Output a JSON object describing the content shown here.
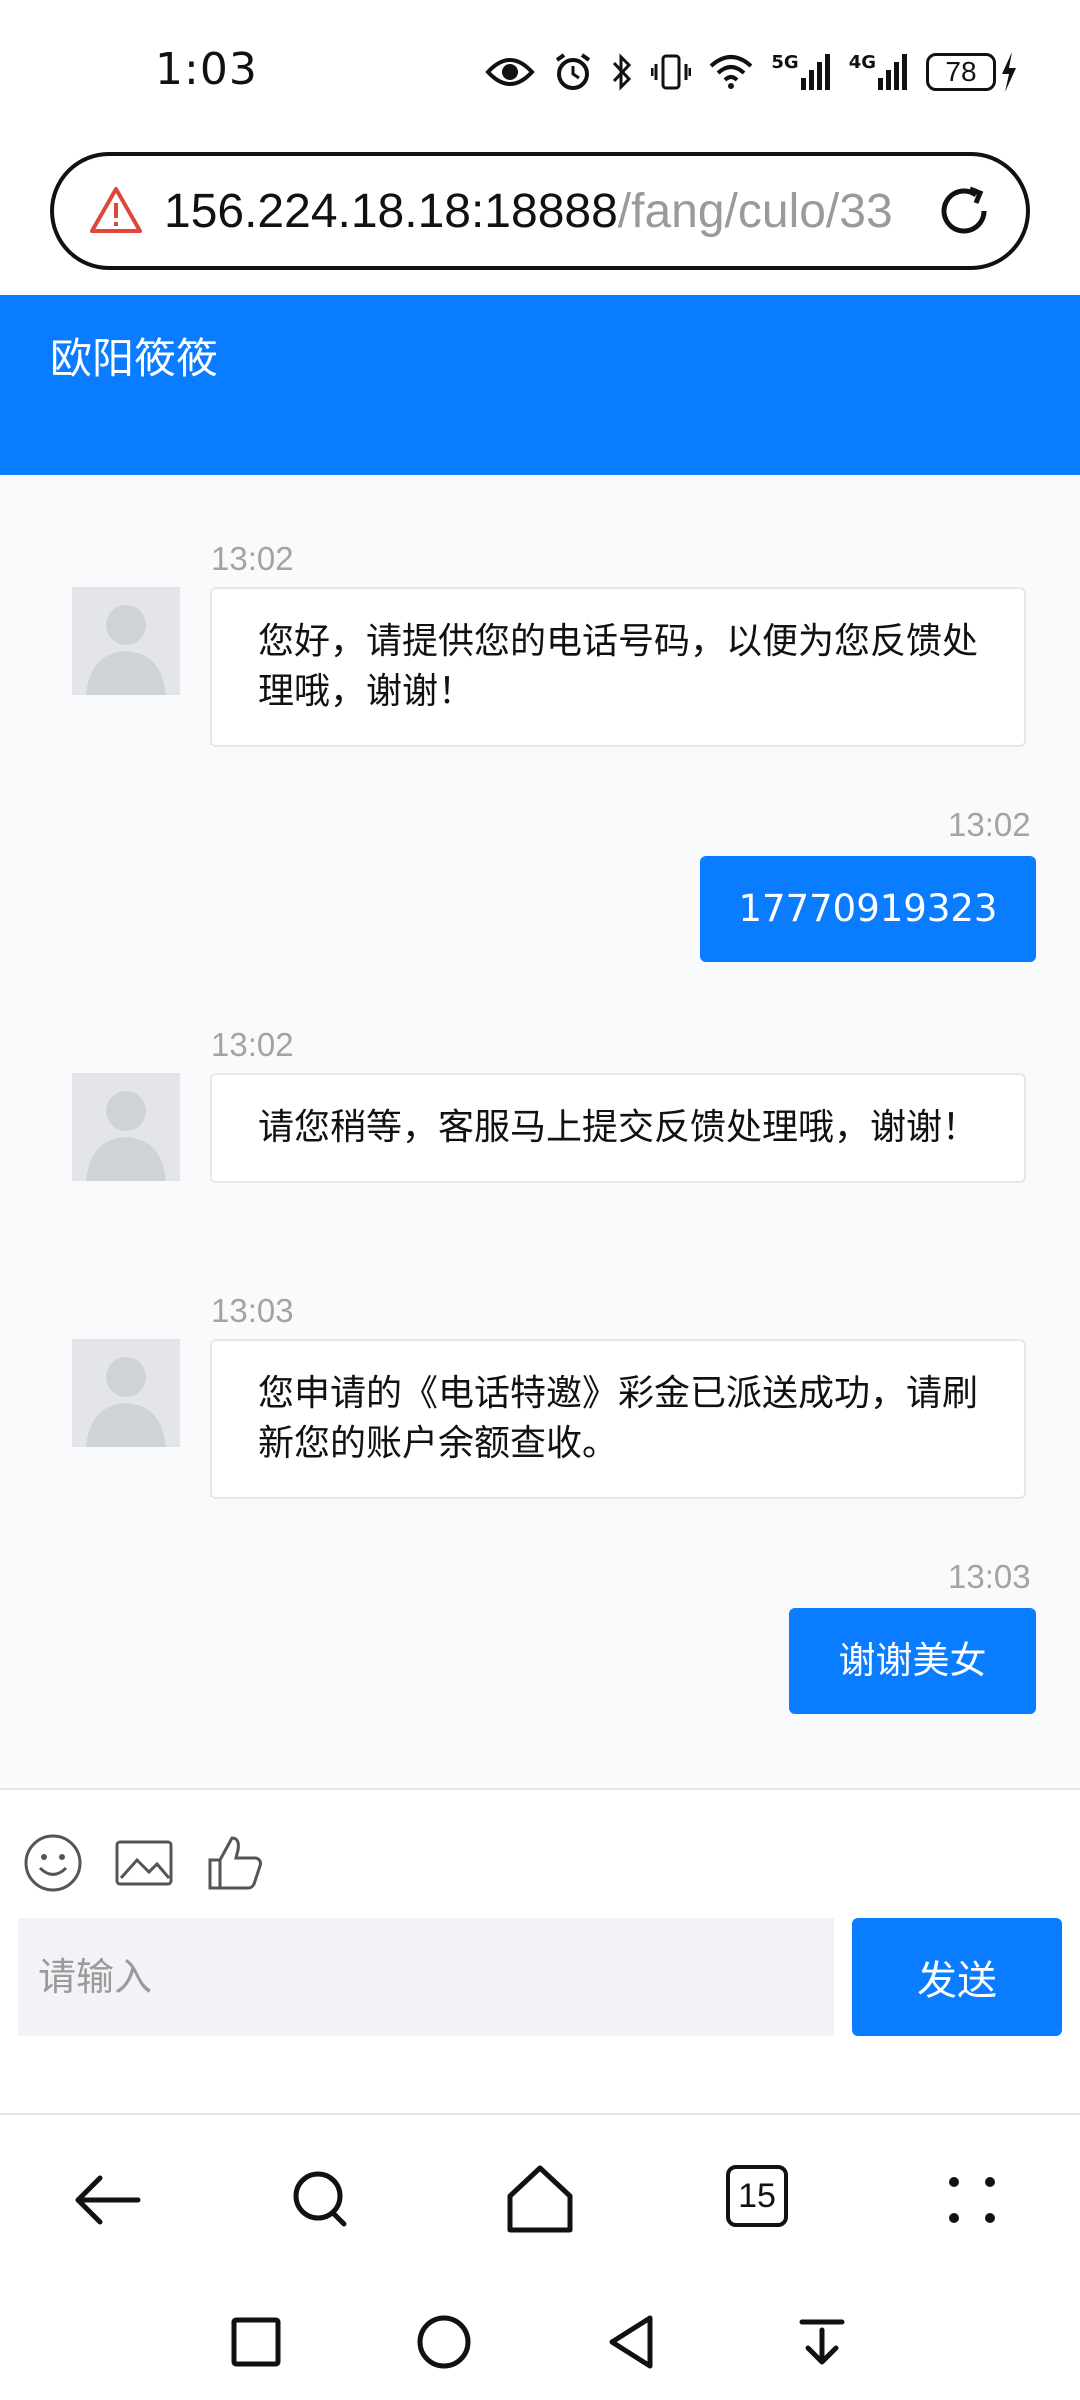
{
  "status_bar": {
    "time": "1:03",
    "battery": "78",
    "network_1": "5G",
    "network_2": "4G",
    "icons": [
      "eye-icon",
      "alarm-icon",
      "bluetooth-icon",
      "vibrate-icon",
      "wifi-icon",
      "signal-5g-icon",
      "signal-4g-icon",
      "battery-icon",
      "charging-icon"
    ]
  },
  "url_bar": {
    "host": "156.224.18.18:18888",
    "path": "/fang/culo/33",
    "warning_icon": "warning-triangle-icon",
    "reload_icon": "reload-icon"
  },
  "chat": {
    "title": "欧阳筱筱",
    "messages": [
      {
        "direction": "in",
        "time": "13:02",
        "text": "您好，请提供您的电话号码，以便为您反馈处理哦，谢谢！"
      },
      {
        "direction": "out",
        "time": "13:02",
        "text": "17770919323"
      },
      {
        "direction": "in",
        "time": "13:02",
        "text": "请您稍等，客服马上提交反馈处理哦，谢谢！"
      },
      {
        "direction": "in",
        "time": "13:03",
        "text": "您申请的《电话特邀》彩金已派送成功，请刷新您的账户余额查收。"
      },
      {
        "direction": "out",
        "time": "13:03",
        "text": "谢谢美女"
      }
    ]
  },
  "composer": {
    "placeholder": "请输入",
    "send_label": "发送",
    "tools": [
      "emoji-icon",
      "image-icon",
      "thumbs-up-icon"
    ]
  },
  "browser_nav": {
    "tabs_count": "15",
    "icons": [
      "back-arrow-icon",
      "search-icon",
      "home-icon",
      "tabs-icon",
      "more-dots-icon"
    ]
  },
  "system_nav": {
    "icons": [
      "recents-square-icon",
      "home-circle-icon",
      "back-triangle-icon",
      "pull-down-icon"
    ]
  }
}
